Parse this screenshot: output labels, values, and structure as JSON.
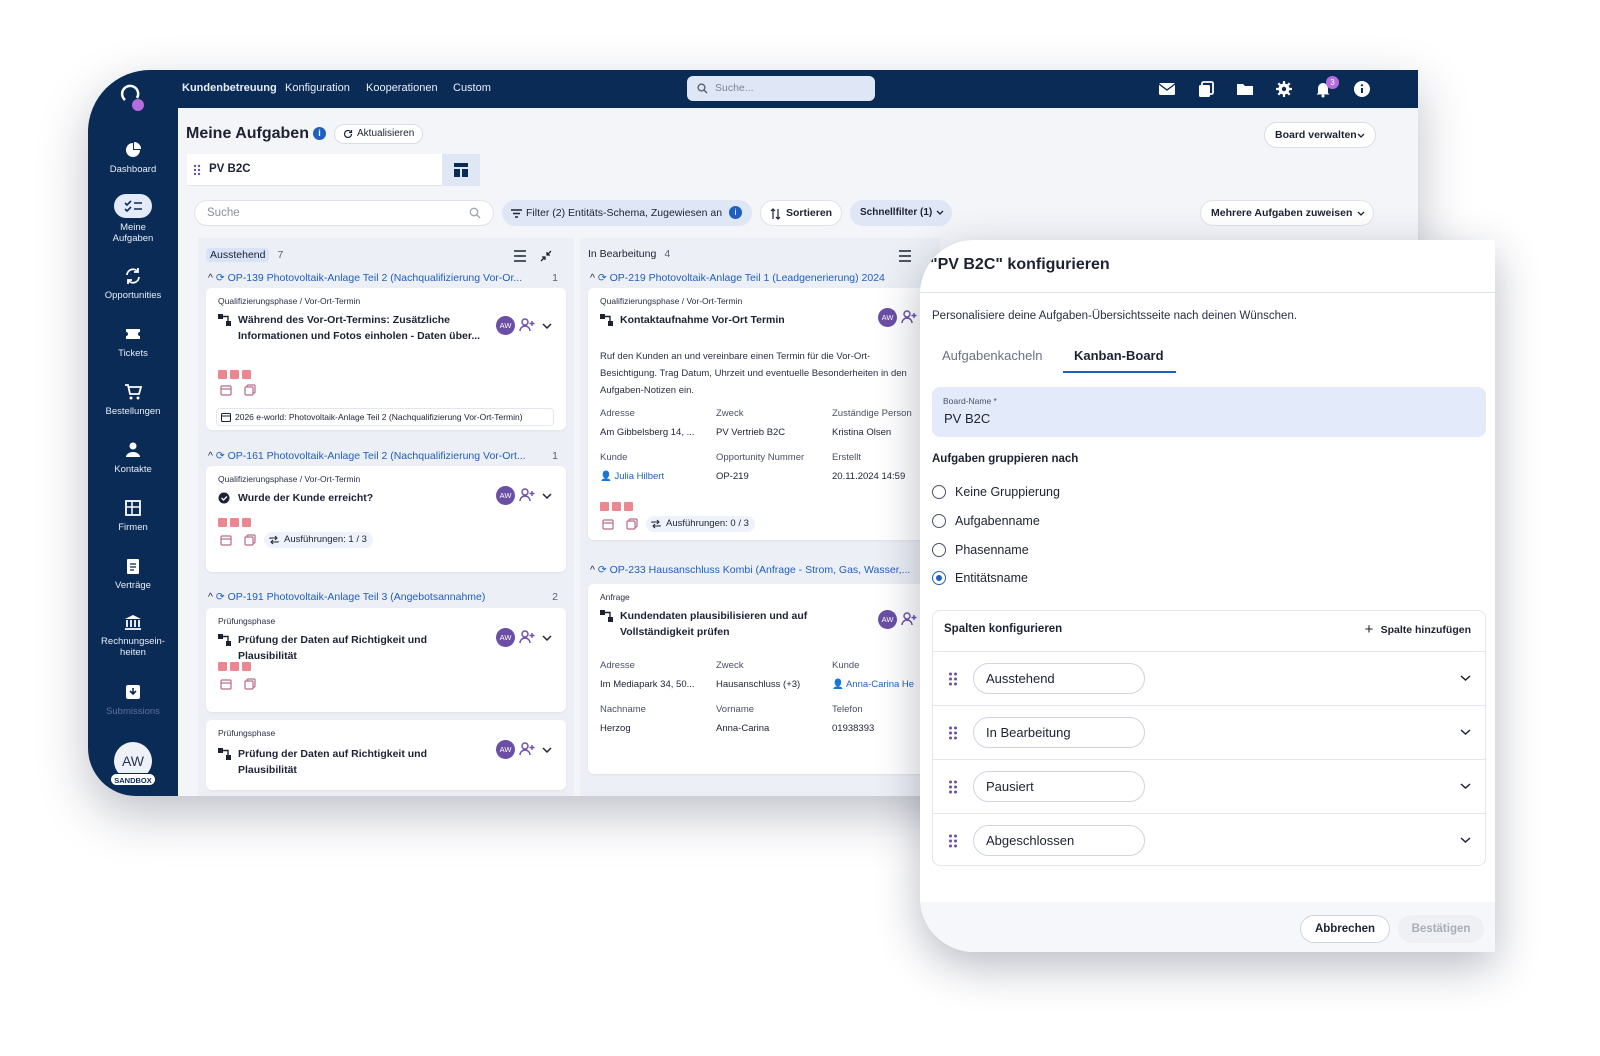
{
  "topbar": {
    "nav": [
      "Kundenbetreuung",
      "Konfiguration",
      "Kooperationen",
      "Custom"
    ],
    "search_placeholder": "Suche...",
    "notification_count": "3"
  },
  "sidebar": {
    "items": [
      {
        "label": "Dashboard",
        "icon": "dashboard-icon"
      },
      {
        "label": "Meine Aufgaben",
        "icon": "tasks-icon"
      },
      {
        "label": "Opportunities",
        "icon": "sync-icon"
      },
      {
        "label": "Tickets",
        "icon": "ticket-icon"
      },
      {
        "label": "Bestellungen",
        "icon": "cart-icon"
      },
      {
        "label": "Kontakte",
        "icon": "person-icon"
      },
      {
        "label": "Firmen",
        "icon": "building-icon"
      },
      {
        "label": "Verträge",
        "icon": "clipboard-icon"
      },
      {
        "label": "Rechnungsein-heiten",
        "icon": "bank-icon"
      },
      {
        "label": "Submissions",
        "icon": "inbox-icon"
      }
    ],
    "avatar": "AW",
    "sandbox": "SANDBOX"
  },
  "page": {
    "title": "Meine Aufgaben",
    "refresh": "Aktualisieren",
    "board_manage": "Board verwalten",
    "board_name": "PV B2C",
    "search_placeholder": "Suche",
    "filter": "Filter (2) Entitäts-Schema, Zugewiesen an",
    "sort": "Sortieren",
    "quickfilter": "Schnellfilter (1)",
    "assign_multiple": "Mehrere Aufgaben zuweisen"
  },
  "columns": [
    {
      "title": "Ausstehend",
      "count": "7",
      "groups": [
        {
          "title": "OP-139 Photovoltaik-Anlage Teil 2 (Nachqualifizierung Vor-Or...",
          "count": "1"
        },
        {
          "title": "OP-161 Photovoltaik-Anlage Teil 2 (Nachqualifizierung Vor-Ort...",
          "count": "1"
        },
        {
          "title": "OP-191 Photovoltaik-Anlage Teil 3 (Angebotsannahme)",
          "count": "2"
        }
      ],
      "cards": [
        {
          "phase": "Qualifizierungsphase / Vor-Ort-Termin",
          "title": "Während des Vor-Ort-Termins: Zusätzliche Informationen und Fotos einholen - Daten über...",
          "link": "2026 e-world: Photovoltaik-Anlage Teil 2 (Nachqualifizierung Vor-Ort-Termin)"
        },
        {
          "phase": "Qualifizierungsphase / Vor-Ort-Termin",
          "title": "Wurde der Kunde erreicht?",
          "tag": "Ausführungen: 1 / 3"
        },
        {
          "phase": "Prüfungsphase",
          "title": "Prüfung der Daten auf Richtigkeit und Plausibilität"
        },
        {
          "phase": "Prüfungsphase",
          "title": "Prüfung der Daten auf Richtigkeit und Plausibilität"
        }
      ]
    },
    {
      "title": "In Bearbeitung",
      "count": "4",
      "groups": [
        {
          "title": "OP-219 Photovoltaik-Anlage Teil 1 (Leadgenerierung) 2024",
          "count": ""
        },
        {
          "title": "OP-233 Hausanschluss Kombi (Anfrage - Strom, Gas, Wasser,...",
          "count": ""
        }
      ],
      "cards": [
        {
          "phase": "Qualifizierungsphase / Vor-Ort-Termin",
          "title": "Kontaktaufnahme Vor-Ort Termin",
          "description": "Ruf den Kunden an und vereinbare einen Termin für die Vor-Ort-Besichtigung. Trag Datum, Uhrzeit und eventuelle Besonderheiten in den Aufgaben-Notizen ein.",
          "fields": [
            {
              "k": "Adresse",
              "v": "Am Gibbelsberg 14, ..."
            },
            {
              "k": "Zweck",
              "v": "PV Vertrieb B2C"
            },
            {
              "k": "Zuständige Person",
              "v": "Kristina Olsen"
            },
            {
              "k": "Kunde",
              "v": "Julia Hilbert"
            },
            {
              "k": "Opportunity Nummer",
              "v": "OP-219"
            },
            {
              "k": "Erstellt",
              "v": "20.11.2024 14:59"
            }
          ],
          "tag": "Ausführungen: 0 / 3"
        },
        {
          "phase": "Anfrage",
          "title": "Kundendaten plausibilisieren und auf Vollständigkeit prüfen",
          "fields": [
            {
              "k": "Adresse",
              "v": "Im Mediapark 34, 50..."
            },
            {
              "k": "Zweck",
              "v": "Hausanschluss (+3)"
            },
            {
              "k": "Kunde",
              "v": "Anna-Carina He"
            },
            {
              "k": "Nachname",
              "v": "Herzog"
            },
            {
              "k": "Vorname",
              "v": "Anna-Carina"
            },
            {
              "k": "Telefon",
              "v": "01938393"
            }
          ]
        }
      ]
    }
  ],
  "dialog": {
    "title": "\"PV B2C\" konfigurieren",
    "subtitle": "Personalisiere deine Aufgaben-Übersichtsseite nach deinen Wünschen.",
    "tabs": [
      "Aufgabenkacheln",
      "Kanban-Board"
    ],
    "board_name_label": "Board-Name *",
    "board_name_value": "PV B2C",
    "group_by_heading": "Aufgaben gruppieren nach",
    "group_options": [
      "Keine Gruppierung",
      "Aufgabenname",
      "Phasenname",
      "Entitätsname"
    ],
    "selected_option": "Entitätsname",
    "columns_heading": "Spalten konfigurieren",
    "add_column": "Spalte hinzufügen",
    "columns": [
      "Ausstehend",
      "In Bearbeitung",
      "Pausiert",
      "Abgeschlossen"
    ],
    "cancel": "Abbrechen",
    "confirm": "Bestätigen"
  },
  "avatar_initials": "AW",
  "colors": {
    "navy": "#0b2b57",
    "accent": "#1f5fbf",
    "priority": "#ec8792",
    "avatar": "#6b4fa4"
  }
}
